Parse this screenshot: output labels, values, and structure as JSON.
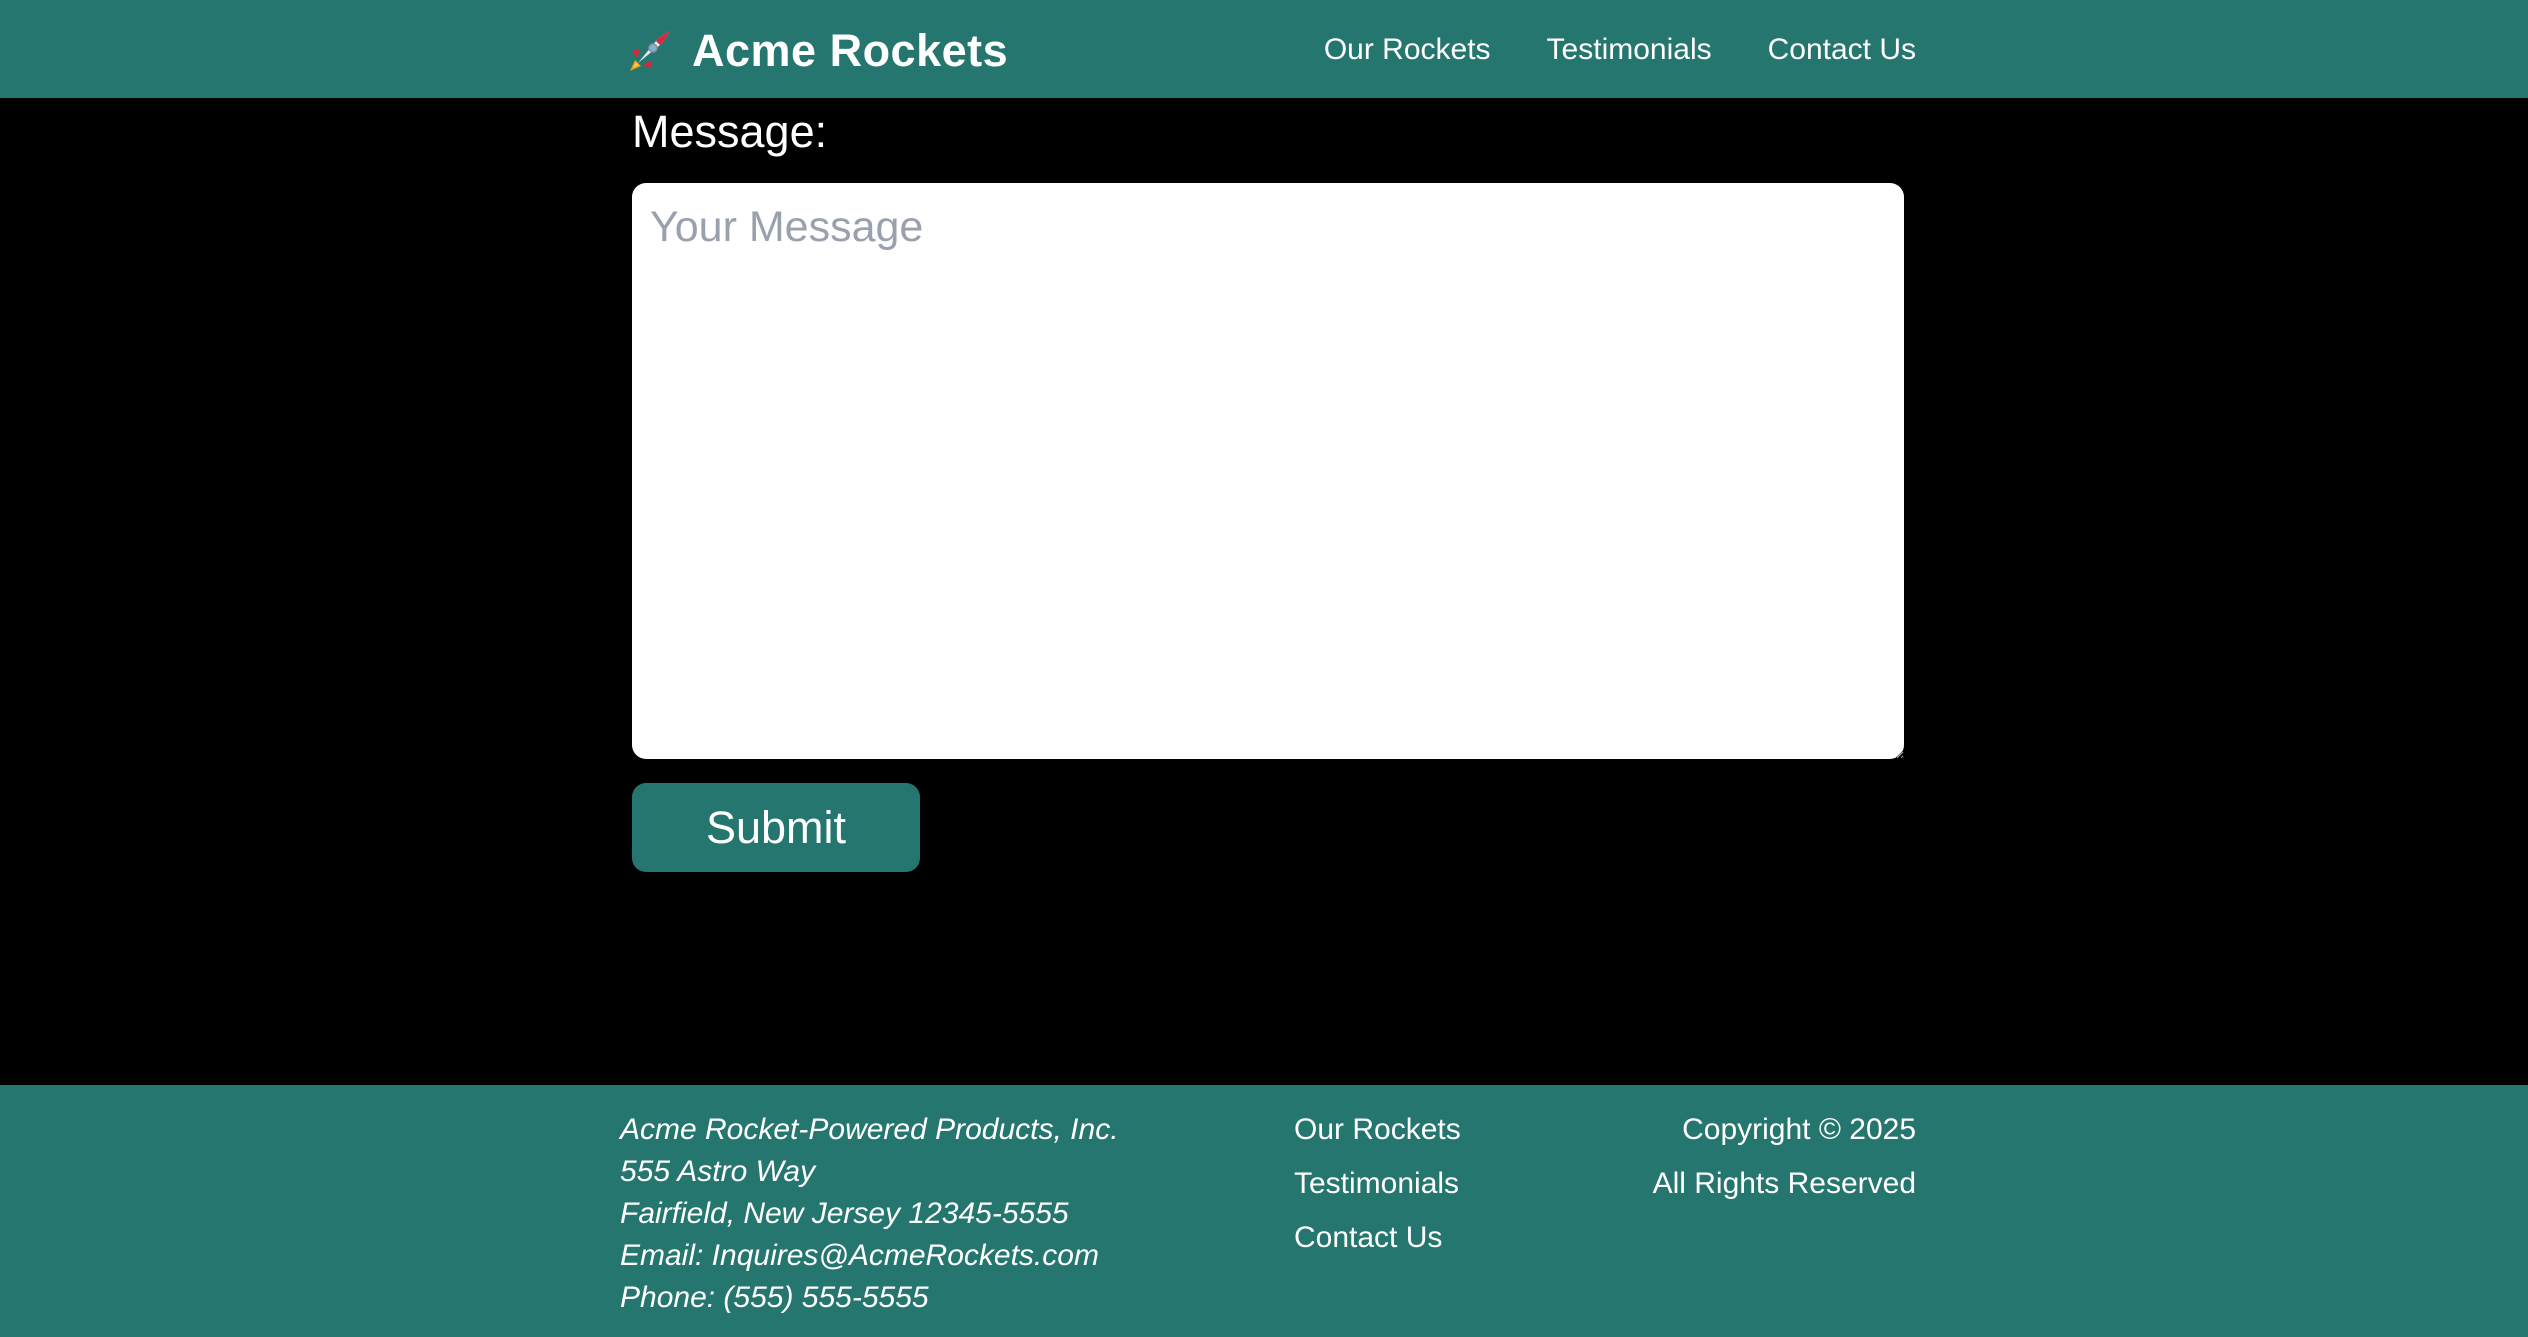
{
  "header": {
    "brand_name": "Acme Rockets",
    "brand_icon": "rocket-icon",
    "nav": [
      {
        "label": "Our Rockets"
      },
      {
        "label": "Testimonials"
      },
      {
        "label": "Contact Us"
      }
    ]
  },
  "form": {
    "message_label": "Message:",
    "message_placeholder": "Your Message",
    "message_value": "",
    "submit_label": "Submit"
  },
  "footer": {
    "address_lines": [
      "Acme Rocket-Powered Products, Inc.",
      "555 Astro Way",
      "Fairfield, New Jersey 12345-5555",
      "Email: Inquires@AcmeRockets.com",
      "Phone: (555) 555-5555"
    ],
    "links": [
      {
        "label": "Our Rockets"
      },
      {
        "label": "Testimonials"
      },
      {
        "label": "Contact Us"
      }
    ],
    "copyright": "Copyright © 2025",
    "rights": "All Rights Reserved"
  },
  "colors": {
    "brand_teal": "#25766f",
    "page_background": "#000000",
    "text_white": "#ffffff",
    "placeholder_gray": "#9aa1ae",
    "rocket_red": "#d7263d"
  }
}
